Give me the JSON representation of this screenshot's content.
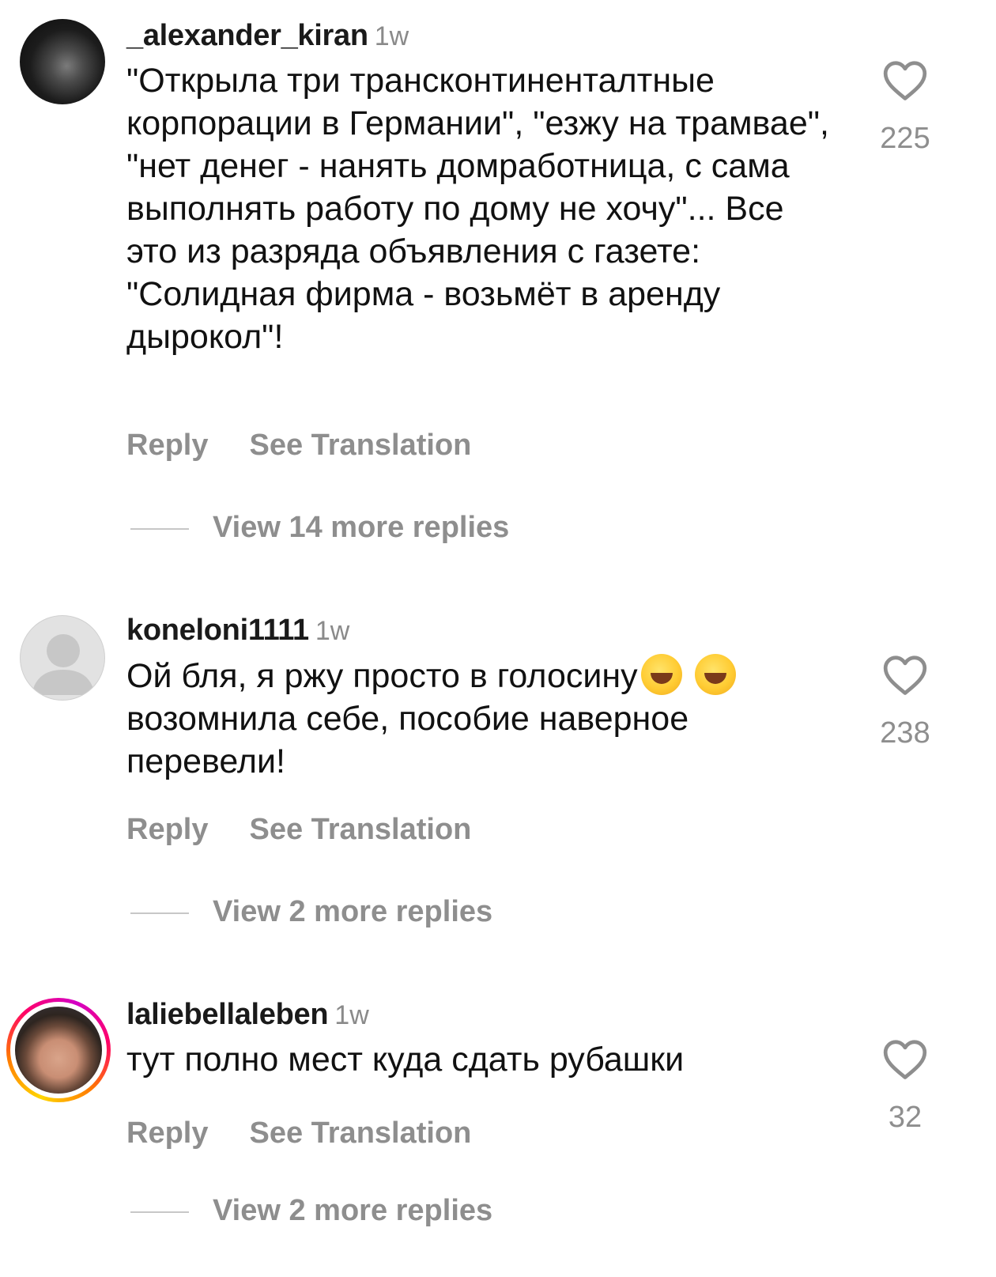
{
  "comments": [
    {
      "username": "_alexander_kiran",
      "time": "1w",
      "text": "\"Открыла три трансконтиненталтные корпорации в Германии\", \"езжу на трамвае\", \"нет денег - нанять домработница, с сама выполнять работу по дому не хочу\"... Все это из разряда объявления с газете: \"Солидная фирма - возьмёт в аренду дырокол\"!",
      "reply_label": "Reply",
      "translate_label": "See Translation",
      "view_replies": "View 14 more replies",
      "likes": "225",
      "avatar_icon": "dark-photo-avatar"
    },
    {
      "username": "koneloni1111",
      "time": "1w",
      "text_before_emoji": "Ой бля, я ржу просто в голосину",
      "text_after_emoji": "возомнила себе, пособие наверное перевели!",
      "emoji_icon": "rolling-on-floor-laughing-emoji",
      "reply_label": "Reply",
      "translate_label": "See Translation",
      "view_replies": "View 2 more replies",
      "likes": "238",
      "avatar_icon": "default-person-avatar"
    },
    {
      "username": "laliebellaleben",
      "time": "1w",
      "text": "тут полно мест куда сдать рубашки",
      "reply_label": "Reply",
      "translate_label": "See Translation",
      "view_replies": "View 2 more replies",
      "likes": "32",
      "avatar_icon": "photo-avatar-with-story-ring"
    }
  ],
  "colors": {
    "secondary_text": "#8e8e8e",
    "story_ring_start": "#ffd600",
    "story_ring_mid": "#ff0069",
    "story_ring_end": "#d300c5"
  }
}
